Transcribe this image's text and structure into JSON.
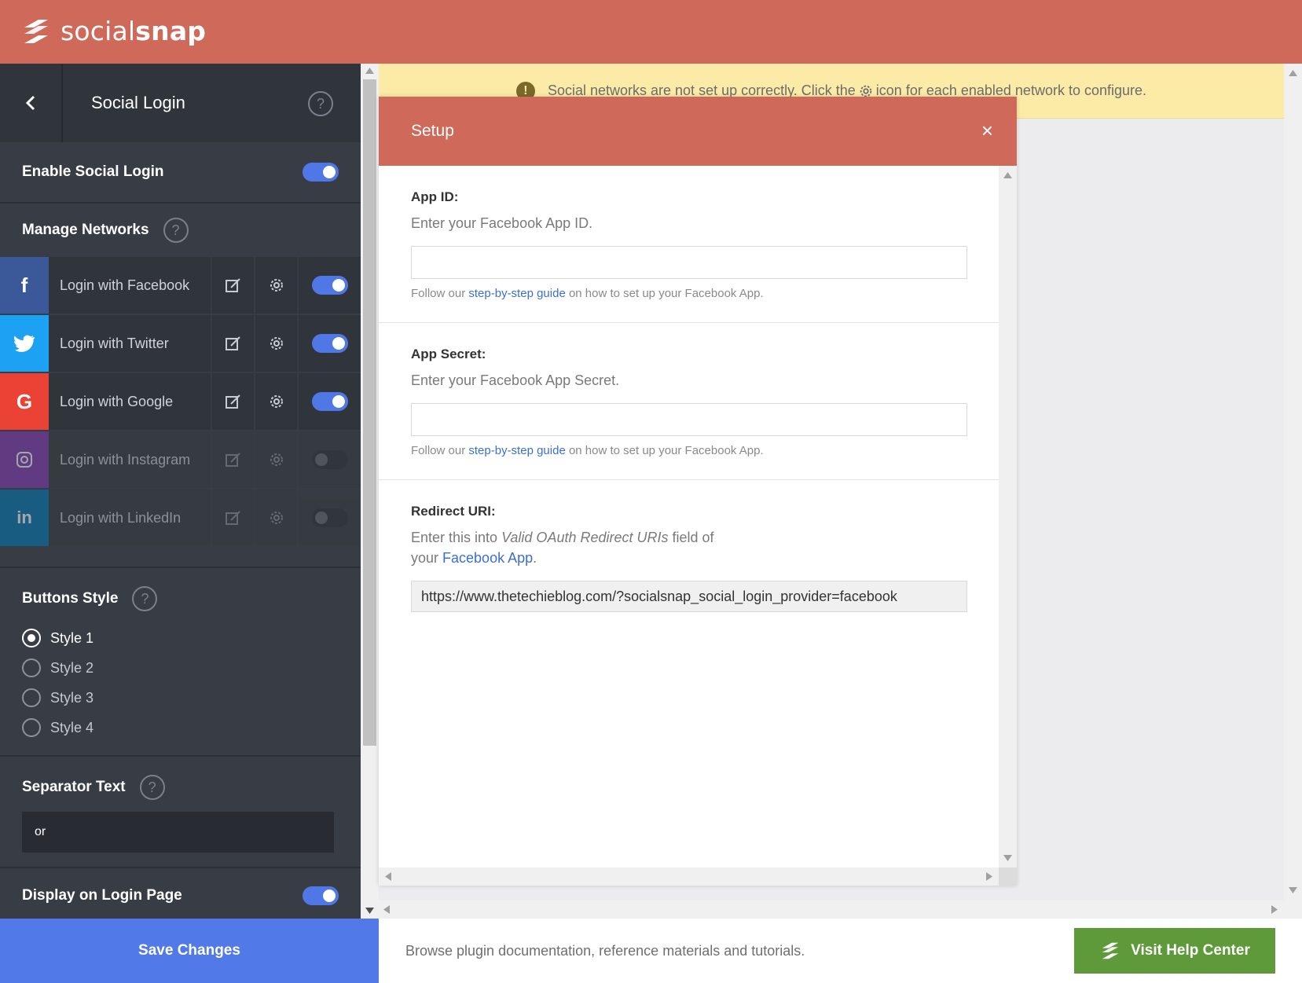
{
  "brand": {
    "name_light": "social",
    "name_bold": "snap"
  },
  "sidebar": {
    "title": "Social Login",
    "enable_label": "Enable Social Login",
    "manage_label": "Manage Networks",
    "networks": [
      {
        "label": "Login with Facebook",
        "color": "#3b5998",
        "icon": "facebook-icon",
        "enabled": true
      },
      {
        "label": "Login with Twitter",
        "color": "#1da1f2",
        "icon": "twitter-icon",
        "enabled": true
      },
      {
        "label": "Login with Google",
        "color": "#ea4335",
        "icon": "google-icon",
        "enabled": true
      },
      {
        "label": "Login with Instagram",
        "color": "#833ab4",
        "icon": "instagram-icon",
        "enabled": false
      },
      {
        "label": "Login with LinkedIn",
        "color": "#0077b5",
        "icon": "linkedin-icon",
        "enabled": false
      }
    ],
    "buttons_style_label": "Buttons Style",
    "styles": [
      "Style 1",
      "Style 2",
      "Style 3",
      "Style 4"
    ],
    "selected_style": "Style 1",
    "separator_label": "Separator Text",
    "separator_value": "or",
    "display_login_label": "Display on Login Page",
    "help_glyph": "?"
  },
  "warning": {
    "before": "Social networks are not set up correctly. Click the",
    "after": "icon for each enabled network to configure."
  },
  "modal": {
    "title": "Setup",
    "close_glyph": "×",
    "app_id": {
      "label": "App ID:",
      "desc": "Enter your Facebook App ID.",
      "value": "",
      "hint_before": "Follow our",
      "hint_link": "step-by-step guide",
      "hint_after": "on how to set up your Facebook App."
    },
    "app_secret": {
      "label": "App Secret:",
      "desc": "Enter your Facebook App Secret.",
      "value": "",
      "hint_before": "Follow our",
      "hint_link": "step-by-step guide",
      "hint_after": "on how to set up your Facebook App."
    },
    "redirect": {
      "label": "Redirect URI:",
      "desc_before": "Enter this into",
      "desc_em": "Valid OAuth Redirect URIs",
      "desc_after": "field of your",
      "desc_link": "Facebook App",
      "desc_end": ".",
      "value": "https://www.thetechieblog.com/?socialsnap_social_login_provider=facebook"
    }
  },
  "footer": {
    "save_label": "Save Changes",
    "text": "Browse plugin documentation, reference materials and tutorials.",
    "help_label": "Visit Help Center"
  },
  "colors": {
    "topbar": "#cf695a",
    "accent_blue": "#5179e8",
    "help_green": "#5f9a3a",
    "warning_bg": "#fbeba7"
  }
}
